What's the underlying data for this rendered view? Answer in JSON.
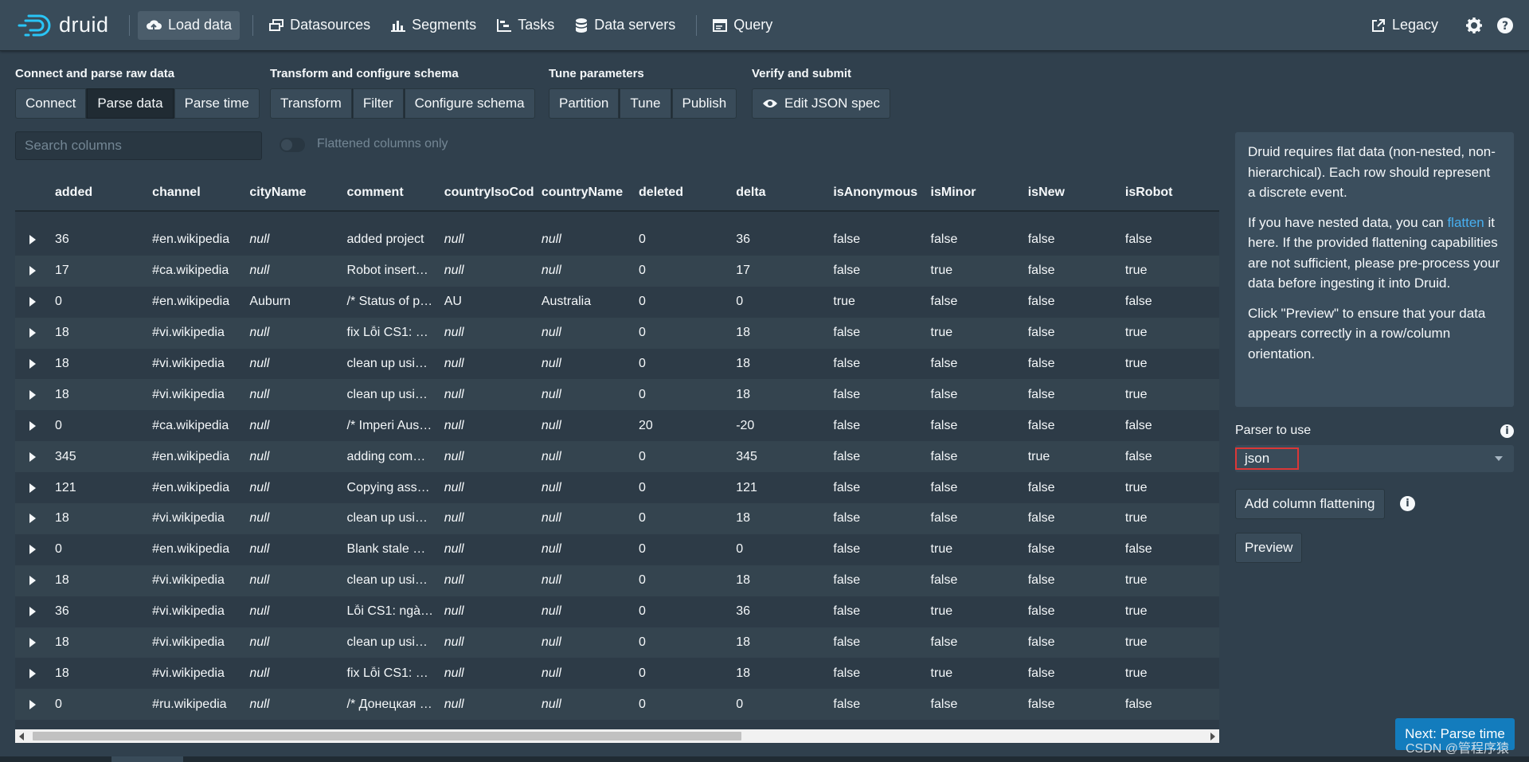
{
  "nav": {
    "brand": "druid",
    "items": [
      {
        "label": "Load data",
        "icon": "cloud-upload-icon",
        "active": true
      },
      {
        "label": "Datasources",
        "icon": "multi-select-icon"
      },
      {
        "label": "Segments",
        "icon": "stacked-chart-icon"
      },
      {
        "label": "Tasks",
        "icon": "gantt-chart-icon"
      },
      {
        "label": "Data servers",
        "icon": "database-icon"
      },
      {
        "label": "Query",
        "icon": "application-icon"
      }
    ],
    "legacy": "Legacy"
  },
  "steps": [
    {
      "title": "Connect and parse raw data",
      "buttons": [
        "Connect",
        "Parse data",
        "Parse time"
      ],
      "active": "Parse data"
    },
    {
      "title": "Transform and configure schema",
      "buttons": [
        "Transform",
        "Filter",
        "Configure schema"
      ]
    },
    {
      "title": "Tune parameters",
      "buttons": [
        "Partition",
        "Tune",
        "Publish"
      ]
    },
    {
      "title": "Verify and submit",
      "buttons": [
        "Edit JSON spec"
      ]
    }
  ],
  "search": {
    "placeholder": "Search columns"
  },
  "flatten_toggle": {
    "label": "Flattened columns only"
  },
  "table": {
    "columns": [
      "added",
      "channel",
      "cityName",
      "comment",
      "countryIsoCod",
      "countryName",
      "deleted",
      "delta",
      "isAnonymous",
      "isMinor",
      "isNew",
      "isRobot"
    ],
    "rows": [
      [
        "36",
        "#en.wikipedia",
        "null",
        "added project",
        "null",
        "null",
        "0",
        "36",
        "false",
        "false",
        "false",
        "false"
      ],
      [
        "17",
        "#ca.wikipedia",
        "null",
        "Robot inserta…",
        "null",
        "null",
        "0",
        "17",
        "false",
        "true",
        "false",
        "true"
      ],
      [
        "0",
        "#en.wikipedia",
        "Auburn",
        "/* Status of p…",
        "AU",
        "Australia",
        "0",
        "0",
        "true",
        "false",
        "false",
        "false"
      ],
      [
        "18",
        "#vi.wikipedia",
        "null",
        "fix Lỗi CS1: n…",
        "null",
        "null",
        "0",
        "18",
        "false",
        "true",
        "false",
        "true"
      ],
      [
        "18",
        "#vi.wikipedia",
        "null",
        "clean up usin…",
        "null",
        "null",
        "0",
        "18",
        "false",
        "false",
        "false",
        "true"
      ],
      [
        "18",
        "#vi.wikipedia",
        "null",
        "clean up usin…",
        "null",
        "null",
        "0",
        "18",
        "false",
        "false",
        "false",
        "true"
      ],
      [
        "0",
        "#ca.wikipedia",
        "null",
        "/* Imperi Aus…",
        "null",
        "null",
        "20",
        "-20",
        "false",
        "false",
        "false",
        "false"
      ],
      [
        "345",
        "#en.wikipedia",
        "null",
        "adding com…",
        "null",
        "null",
        "0",
        "345",
        "false",
        "false",
        "true",
        "false"
      ],
      [
        "121",
        "#en.wikipedia",
        "null",
        "Copying asse…",
        "null",
        "null",
        "0",
        "121",
        "false",
        "false",
        "false",
        "true"
      ],
      [
        "18",
        "#vi.wikipedia",
        "null",
        "clean up usin…",
        "null",
        "null",
        "0",
        "18",
        "false",
        "false",
        "false",
        "true"
      ],
      [
        "0",
        "#en.wikipedia",
        "null",
        "Blank stale w…",
        "null",
        "null",
        "0",
        "0",
        "false",
        "true",
        "false",
        "false"
      ],
      [
        "18",
        "#vi.wikipedia",
        "null",
        "clean up usin…",
        "null",
        "null",
        "0",
        "18",
        "false",
        "false",
        "false",
        "true"
      ],
      [
        "36",
        "#vi.wikipedia",
        "null",
        "Lỗi CS1: ngày…",
        "null",
        "null",
        "0",
        "36",
        "false",
        "true",
        "false",
        "true"
      ],
      [
        "18",
        "#vi.wikipedia",
        "null",
        "clean up usin…",
        "null",
        "null",
        "0",
        "18",
        "false",
        "false",
        "false",
        "true"
      ],
      [
        "18",
        "#vi.wikipedia",
        "null",
        "fix Lỗi CS1: n…",
        "null",
        "null",
        "0",
        "18",
        "false",
        "true",
        "false",
        "true"
      ],
      [
        "0",
        "#ru.wikipedia",
        "null",
        "/* Донецкая …",
        "null",
        "null",
        "0",
        "0",
        "false",
        "false",
        "false",
        "false"
      ]
    ]
  },
  "side": {
    "callout": {
      "p1": "Druid requires flat data (non-nested, non-hierarchical). Each row should represent a discrete event.",
      "p2_before": "If you have nested data, you can ",
      "p2_link": "flatten",
      "p2_after": " it here. If the provided flattening capabilities are not sufficient, please pre-process your data before ingesting it into Druid.",
      "p3": "Click \"Preview\" to ensure that your data appears correctly in a row/column orientation."
    },
    "parser_label": "Parser to use",
    "parser_value": "json",
    "add_flattening": "Add column flattening",
    "preview": "Preview",
    "next": "Next: Parse time"
  },
  "watermark": "CSDN @管程序猿",
  "colors": {
    "accent": "#137cbd",
    "link": "#48aff0",
    "highlight": "#db3737"
  }
}
